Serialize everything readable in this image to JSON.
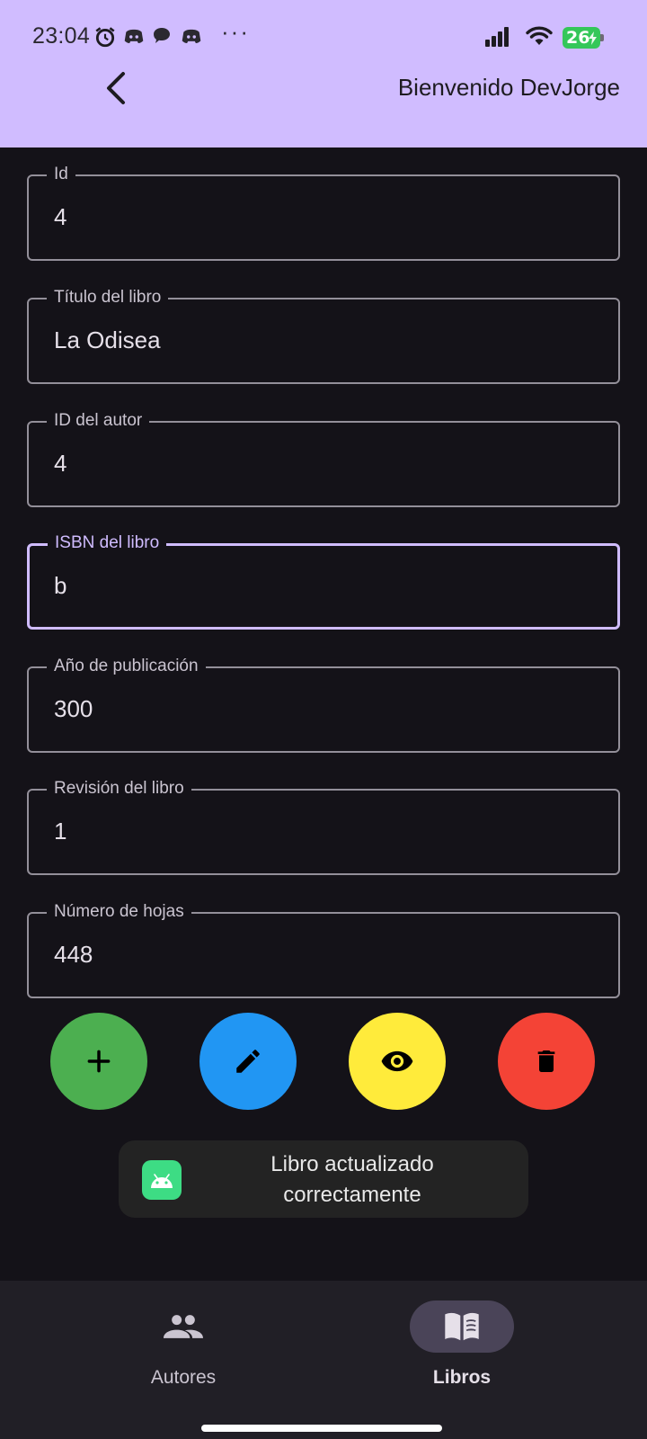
{
  "status_bar": {
    "time": "23:04",
    "notification_icons": [
      "alarm-icon",
      "discord-icon",
      "chat-bubble-icon",
      "discord-icon"
    ],
    "more_indicator": "···",
    "battery_level": "26",
    "battery_color": "#34c759"
  },
  "app_bar": {
    "back_icon": "chevron-left-icon",
    "welcome_text": "Bienvenido DevJorge",
    "background": "#d0bcff"
  },
  "form": {
    "fields": [
      {
        "label": "Id",
        "value": "4",
        "focused": false
      },
      {
        "label": "Título del libro",
        "value": "La Odisea",
        "focused": false
      },
      {
        "label": "ID del autor",
        "value": "4",
        "focused": false
      },
      {
        "label": "ISBN del libro",
        "value": "b",
        "focused": true
      },
      {
        "label": "Año de publicación",
        "value": "300",
        "focused": false
      },
      {
        "label": "Revisión del libro",
        "value": "1",
        "focused": false
      },
      {
        "label": "Número de hojas",
        "value": "448",
        "focused": false
      }
    ]
  },
  "actions": [
    {
      "name": "add",
      "icon": "plus-icon",
      "color": "#4caf50"
    },
    {
      "name": "edit",
      "icon": "pencil-icon",
      "color": "#2196f3"
    },
    {
      "name": "view",
      "icon": "eye-icon",
      "color": "#ffeb3b"
    },
    {
      "name": "delete",
      "icon": "trash-icon",
      "color": "#f44336"
    }
  ],
  "toast": {
    "icon": "android-icon",
    "message": "Libro actualizado correctamente"
  },
  "bottom_nav": {
    "items": [
      {
        "label": "Autores",
        "icon": "people-icon",
        "active": false
      },
      {
        "label": "Libros",
        "icon": "book-icon",
        "active": true
      }
    ]
  }
}
